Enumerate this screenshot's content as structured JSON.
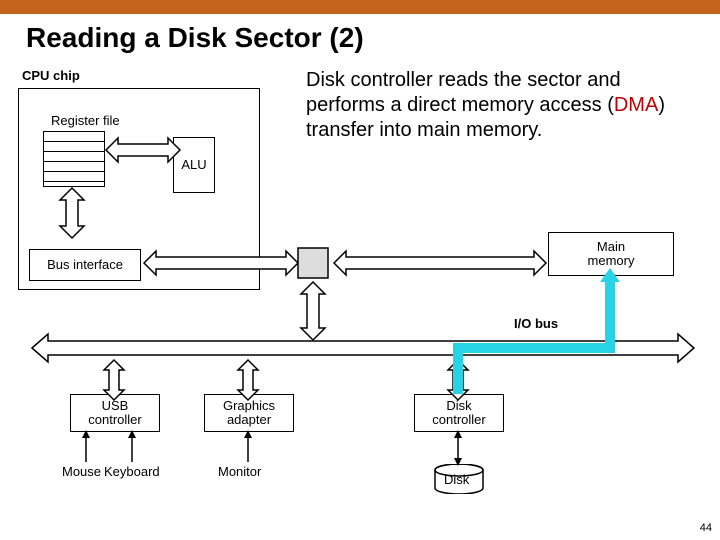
{
  "title": "Reading a Disk Sector (2)",
  "page_number": "44",
  "cpu_chip": {
    "label": "CPU chip",
    "register_file": "Register file",
    "alu": "ALU",
    "bus_interface": "Bus interface"
  },
  "io_bus_label": "I/O bus",
  "main_memory": {
    "l1": "Main",
    "l2": "memory"
  },
  "usb": {
    "l1": "USB",
    "l2": "controller"
  },
  "gfx": {
    "l1": "Graphics",
    "l2": "adapter"
  },
  "diskc": {
    "l1": "Disk",
    "l2": "controller"
  },
  "peripherals": {
    "mouse": "Mouse",
    "keyboard": "Keyboard",
    "monitor": "Monitor",
    "disk": "Disk"
  },
  "description": {
    "pre": "Disk controller reads the sector and performs a direct memory access (",
    "dma": "DMA",
    "post": ") transfer into main memory."
  },
  "colors": {
    "accent": "#c4641c",
    "dma_path": "#29d3e6"
  }
}
